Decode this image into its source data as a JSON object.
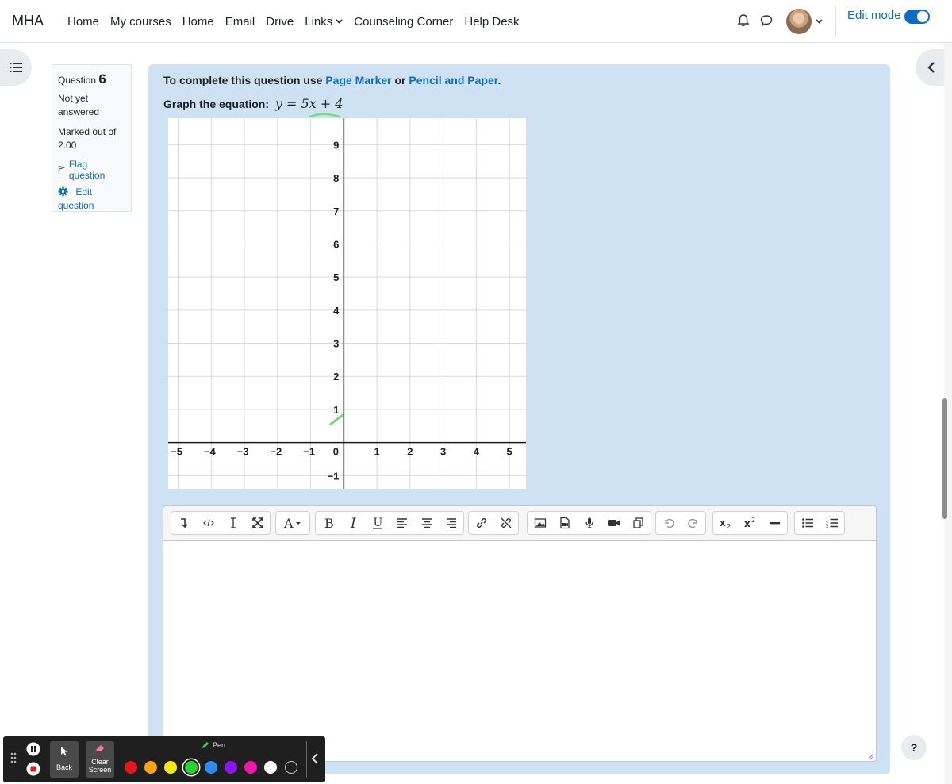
{
  "navbar": {
    "brand": "MHA",
    "links": [
      "Home",
      "My courses",
      "Home",
      "Email",
      "Drive",
      "Links",
      "Counseling Corner",
      "Help Desk"
    ],
    "edit_mode_label": "Edit mode",
    "edit_mode_on": true
  },
  "question_info": {
    "label": "Question",
    "number": "6",
    "state": "Not yet answered",
    "grade": "Marked out of 2.00",
    "flag_label": "Flag question",
    "edit_label": "Edit question"
  },
  "question": {
    "instruction_prefix": "To complete this question use",
    "link1": "Page Marker",
    "instruction_mid": "or",
    "link2": "Pencil and Paper",
    "instruction_suffix": ".",
    "graph_prompt": "Graph the equation:",
    "equation": "y = 5x + 4"
  },
  "chart_data": {
    "type": "line",
    "x_ticks": [
      "−5",
      "−4",
      "−3",
      "−2",
      "−1",
      "0",
      "1",
      "2",
      "3",
      "4",
      "5"
    ],
    "y_ticks": [
      "9",
      "8",
      "7",
      "6",
      "5",
      "4",
      "3",
      "2",
      "1",
      "−1"
    ],
    "xlim": [
      -5.3,
      5.5
    ],
    "ylim": [
      -1.4,
      9.8
    ],
    "grid": true,
    "annotation_color": "#6fdc6f"
  },
  "editor": {
    "toolbar_icons": [
      [
        "insert-icon",
        "html-icon",
        "clear-format-icon",
        "fullscreen-icon"
      ],
      [
        "font-color-icon"
      ],
      [
        "bold-icon",
        "italic-icon",
        "underline-icon",
        "align-left-icon",
        "align-center-icon",
        "align-right-icon"
      ],
      [
        "link-icon",
        "unlink-icon"
      ],
      [
        "image-icon",
        "media-icon",
        "record-audio-icon",
        "record-video-icon",
        "manage-files-icon"
      ],
      [
        "undo-icon",
        "redo-icon"
      ],
      [
        "subscript-icon",
        "superscript-icon",
        "horizontal-rule-icon"
      ],
      [
        "bullet-list-icon",
        "numbered-list-icon"
      ]
    ]
  },
  "annotation_toolbar": {
    "back_label": "Back",
    "clear_label": "Clear Screen",
    "pen_label": "Pen",
    "colors": [
      "#e5151b",
      "#f5a31a",
      "#f5e81a",
      "#2fcf2f",
      "#2d8cf0",
      "#8b18f0",
      "#f018a8",
      "#ffffff",
      "#1f1f1f"
    ],
    "selected_color": "#2fcf2f"
  },
  "help_label": "?"
}
